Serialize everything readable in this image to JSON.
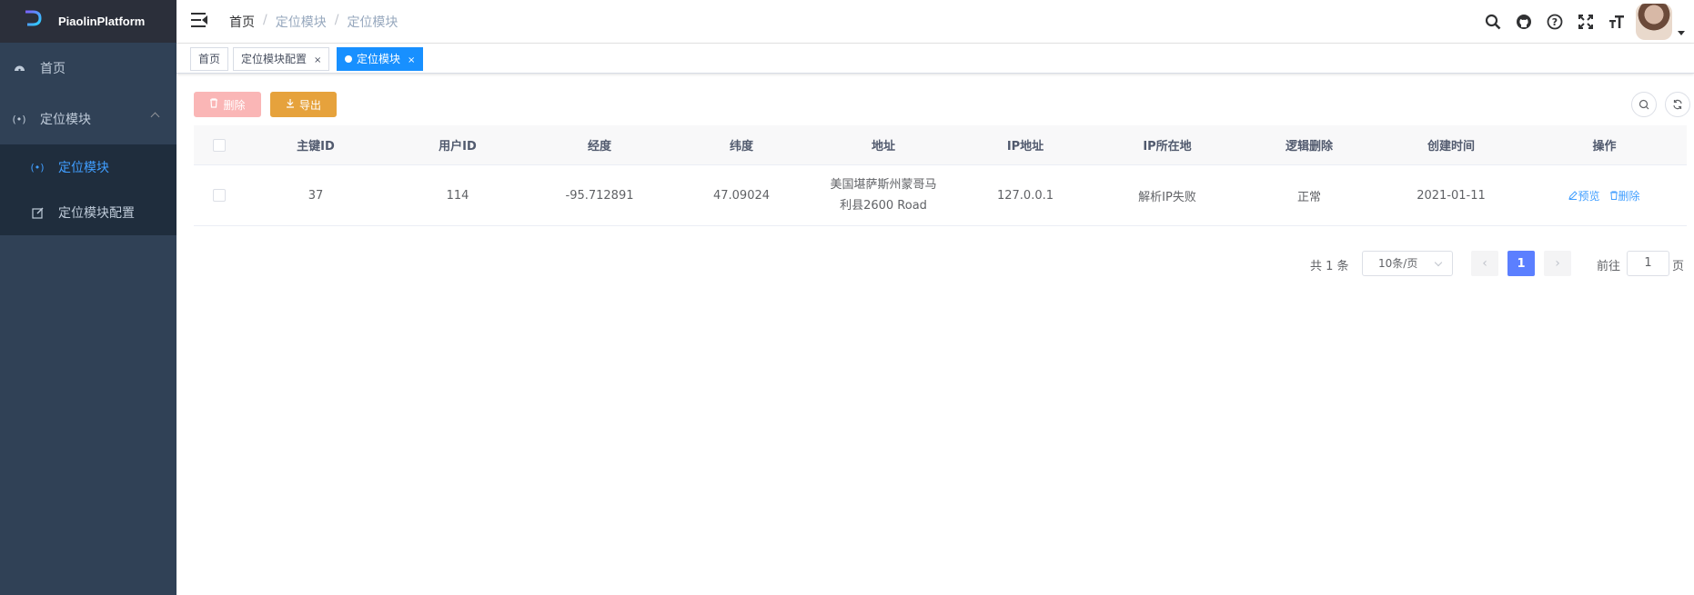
{
  "app": {
    "title": "PiaolinPlatform"
  },
  "sidebar": {
    "items": [
      {
        "label": "首页",
        "icon": "dashboard-icon"
      },
      {
        "label": "定位模块",
        "icon": "broadcast-icon",
        "expanded": true,
        "children": [
          {
            "label": "定位模块",
            "icon": "broadcast-icon",
            "active": true
          },
          {
            "label": "定位模块配置",
            "icon": "edit-icon"
          }
        ]
      }
    ]
  },
  "breadcrumb": [
    "首页",
    "定位模块",
    "定位模块"
  ],
  "tags": [
    {
      "label": "首页",
      "active": false
    },
    {
      "label": "定位模块配置",
      "active": false,
      "closable": true
    },
    {
      "label": "定位模块",
      "active": true,
      "closable": true
    }
  ],
  "toolbar": {
    "delete_label": "删除",
    "export_label": "导出"
  },
  "table": {
    "headers": [
      "主键ID",
      "用户ID",
      "经度",
      "纬度",
      "地址",
      "IP地址",
      "IP所在地",
      "逻辑删除",
      "创建时间",
      "操作"
    ],
    "rows": [
      {
        "id": "37",
        "user_id": "114",
        "longitude": "-95.712891",
        "latitude": "47.09024",
        "address_line1": "美国堪萨斯州蒙哥马",
        "address_line2": "利县2600 Road",
        "ip": "127.0.0.1",
        "ip_location": "解析IP失败",
        "logic_delete": "正常",
        "created": "2021-01-11",
        "op_preview": "预览",
        "op_delete": "删除"
      }
    ]
  },
  "pagination": {
    "total": "共 1 条",
    "page_size": "10条/页",
    "current": "1",
    "goto_label": "前往",
    "goto_value": "1",
    "goto_suffix": "页"
  },
  "colors": {
    "sidebar_bg": "#304156",
    "primary": "#409eff",
    "warning": "#e6a23c",
    "danger_light": "#fab6b6",
    "tag_active": "#1890ff"
  }
}
